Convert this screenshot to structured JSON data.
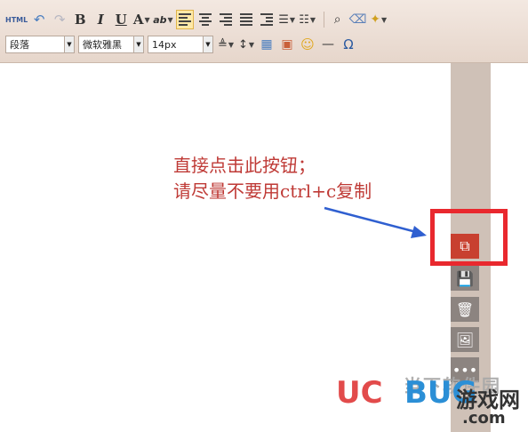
{
  "toolbar": {
    "row1": {
      "html_label": "HTML",
      "bold_label": "B",
      "italic_label": "I",
      "underline_label": "U",
      "font_color_label": "A",
      "highlight_label": "ab"
    },
    "row2": {
      "paragraph_select": "段落",
      "font_select": "微软雅黑",
      "size_select": "14px",
      "omega_label": "Ω"
    }
  },
  "annotation": {
    "line1": "直接点击此按钮；",
    "line2": "请尽量不要用ctrl+c复制"
  },
  "watermark": {
    "uc": "UC",
    "bug": "BUG",
    "site_cn": "当下软件园",
    "games": "游戏网",
    "com": ".com"
  },
  "colors": {
    "annotation_red": "#bf3a36",
    "highlight_box": "#e9282e",
    "copy_button": "#c84030",
    "sidebar": "#cfc1b7"
  },
  "icons": [
    "undo-icon",
    "redo-icon",
    "align-left-icon",
    "align-center-icon",
    "align-right-icon",
    "justify-icon",
    "indent-icon",
    "bullet-list-icon",
    "numbered-list-icon",
    "find-icon",
    "eraser-icon",
    "magic-wand-icon",
    "line-height-icon",
    "spacing-icon",
    "table-icon",
    "image-icon",
    "emoji-icon",
    "horizontal-rule-icon",
    "copy-icon",
    "save-icon",
    "trash-icon",
    "picture-icon",
    "more-icon"
  ]
}
